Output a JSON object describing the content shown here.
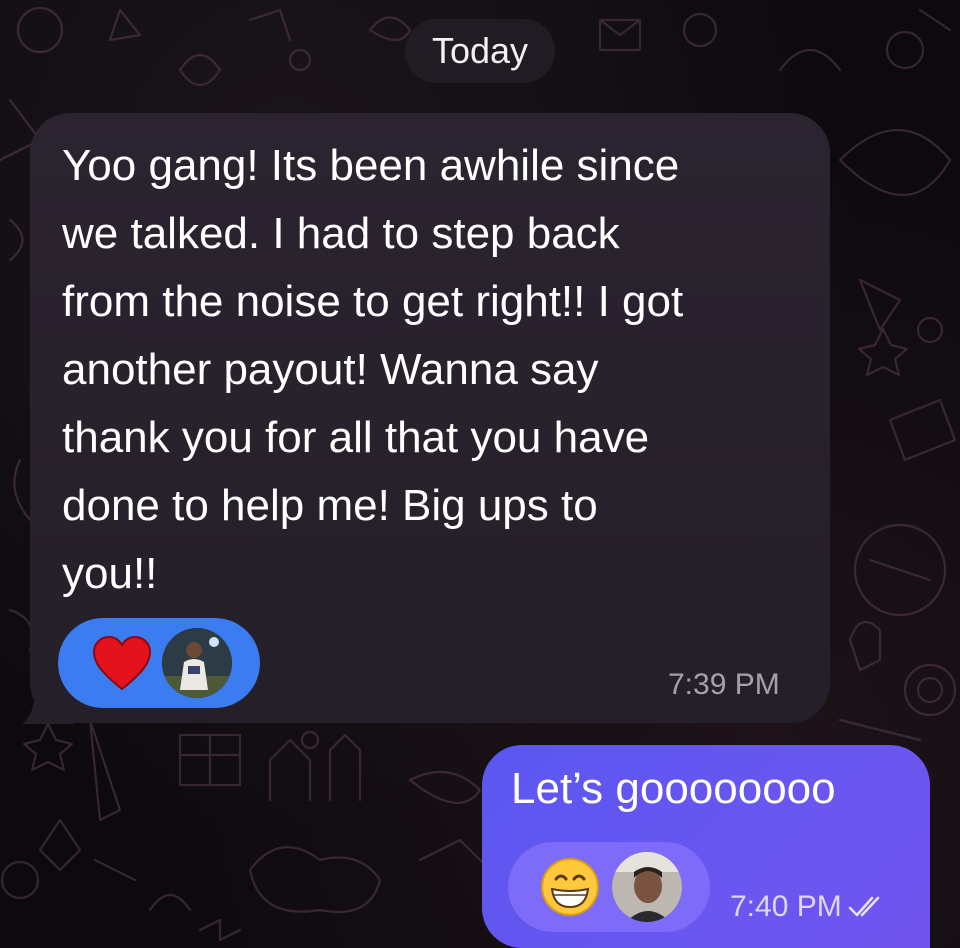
{
  "header": {
    "date_label": "Today"
  },
  "messages": [
    {
      "direction": "incoming",
      "text": "Yoo gang! Its been awhile since\nwe talked. I had to step back\nfrom the noise to get right!! I got\nanother payout! Wanna say\nthank you for all that you have\ndone to help me! Big ups to\nyou!!",
      "time": "7:39 PM",
      "reactions": [
        {
          "emoji_icon": "red-heart-icon"
        },
        {
          "avatar": "reactor-avatar"
        }
      ],
      "bubble_color": "#2a2330",
      "reaction_pill_color": "#3b7df0"
    },
    {
      "direction": "outgoing",
      "text": "Let’s goooooooo",
      "time": "7:40 PM",
      "status_icon": "double-check-icon",
      "reactions": [
        {
          "emoji_icon": "grinning-face-icon"
        },
        {
          "avatar": "reactor-avatar"
        }
      ],
      "bubble_color": "#6356f0"
    }
  ]
}
